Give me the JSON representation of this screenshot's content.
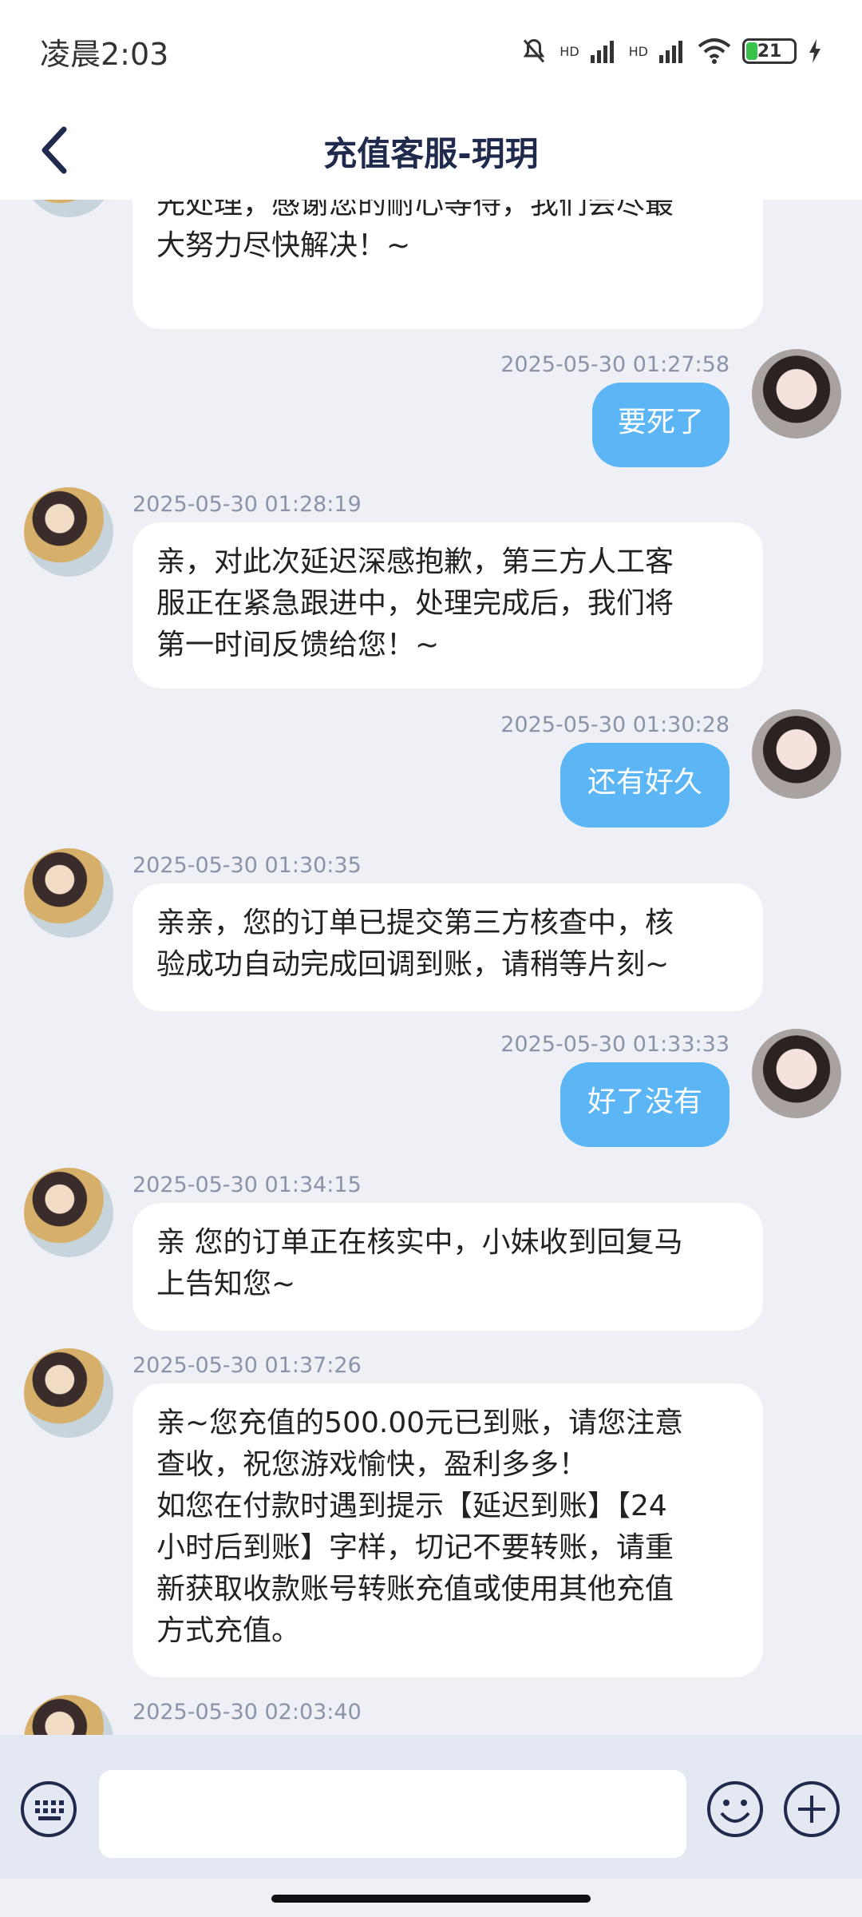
{
  "status_bar": {
    "time": "凌晨2:03",
    "battery": "21",
    "net1": "HD",
    "net2": "HD"
  },
  "header": {
    "title": "充值客服-玥玥",
    "back_icon": "chevron-left-icon"
  },
  "messages": [
    {
      "sender": "agent",
      "timestamp": "",
      "text": "亲，您的反馈小妹已经收到，并已安排优\n先处理，感谢您的耐心等待，我们会尽最\n大努力尽快解决！~"
    },
    {
      "sender": "user",
      "timestamp": "2025-05-30 01:27:58",
      "text": "要死了"
    },
    {
      "sender": "agent",
      "timestamp": "2025-05-30 01:28:19",
      "text": "亲，对此次延迟深感抱歉，第三方人工客\n服正在紧急跟进中，处理完成后，我们将\n第一时间反馈给您！~"
    },
    {
      "sender": "user",
      "timestamp": "2025-05-30 01:30:28",
      "text": "还有好久"
    },
    {
      "sender": "agent",
      "timestamp": "2025-05-30 01:30:35",
      "text": "亲亲，您的订单已提交第三方核查中，核\n验成功自动完成回调到账，请稍等片刻~"
    },
    {
      "sender": "user",
      "timestamp": "2025-05-30 01:33:33",
      "text": "好了没有"
    },
    {
      "sender": "agent",
      "timestamp": "2025-05-30 01:34:15",
      "text": "亲  您的订单正在核实中，小妹收到回复马\n上告知您~"
    },
    {
      "sender": "agent",
      "timestamp": "2025-05-30 01:37:26",
      "text": "亲~您充值的500.00元已到账，请您注意\n查收，祝您游戏愉快，盈利多多！\n如您在付款时遇到提示【延迟到账】【24\n小时后到账】字样，切记不要转账，请重\n新获取收款账号转账充值或使用其他充值\n方式充值。"
    },
    {
      "sender": "agent",
      "timestamp": "2025-05-30 02:03:40",
      "text": ""
    }
  ],
  "input_bar": {
    "placeholder": "",
    "keyboard_icon": "keyboard-icon",
    "emoji_icon": "emoji-icon",
    "plus_icon": "plus-icon"
  },
  "colors": {
    "user_bubble": "#5cb6f5",
    "agent_bubble": "#ffffff",
    "background": "#eef0f6",
    "title": "#1f2a4d"
  }
}
